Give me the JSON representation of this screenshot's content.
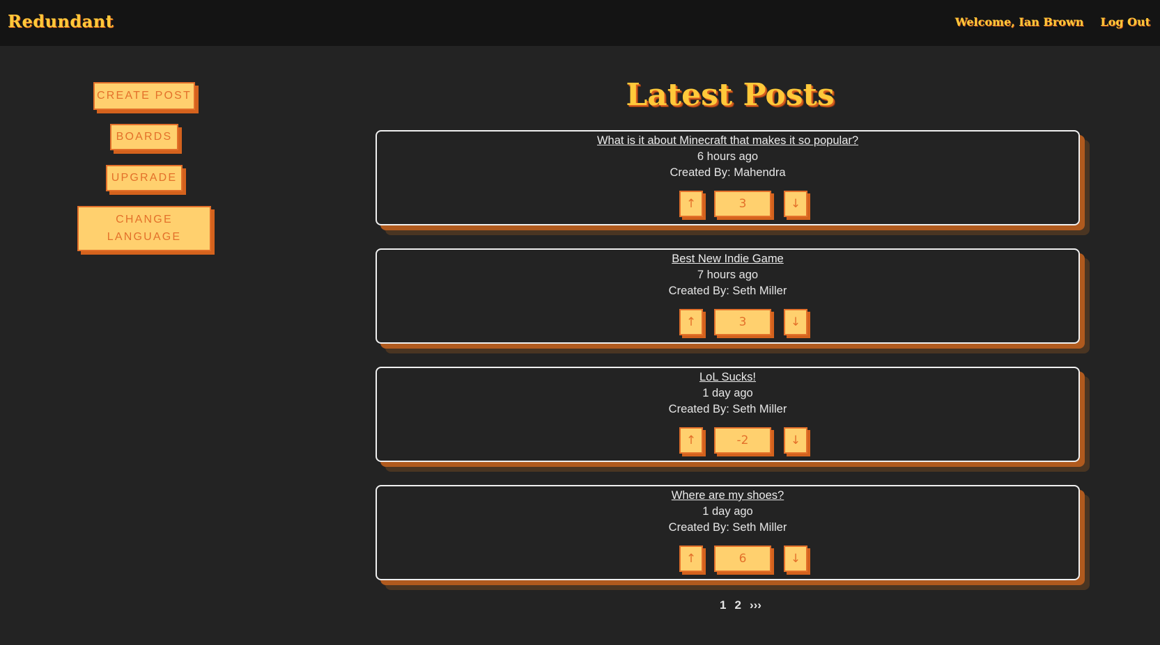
{
  "header": {
    "brand": "Redundant",
    "welcome": "Welcome, Ian Brown",
    "logout": "Log Out"
  },
  "sidebar": {
    "create_post": "CREATE POST",
    "boards": "BOARDS",
    "upgrade": "UPGRADE",
    "change_language_line1": "CHANGE",
    "change_language_line2": "LANGUAGE"
  },
  "main": {
    "title": "Latest Posts"
  },
  "posts": [
    {
      "title": "What is it about Minecraft that makes it so popular?",
      "time": "6 hours ago",
      "author": "Created By: Mahendra",
      "score": "3"
    },
    {
      "title": "Best New Indie Game",
      "time": "7 hours ago",
      "author": "Created By: Seth Miller",
      "score": "3"
    },
    {
      "title": "LoL Sucks!",
      "time": "1 day ago",
      "author": "Created By: Seth Miller",
      "score": "-2"
    },
    {
      "title": "Where are my shoes?",
      "time": "1 day ago",
      "author": "Created By: Seth Miller",
      "score": "6"
    }
  ],
  "vote": {
    "up": "↑",
    "down": "↓"
  },
  "pagination": {
    "page1": "1",
    "page2": "2",
    "next": "›››"
  },
  "colors": {
    "accent": "#ffc93a",
    "button_bg": "#ffd06e",
    "button_text": "#e3702a",
    "shadow": "#d4621d",
    "background": "#232323",
    "topbar": "#141414"
  }
}
